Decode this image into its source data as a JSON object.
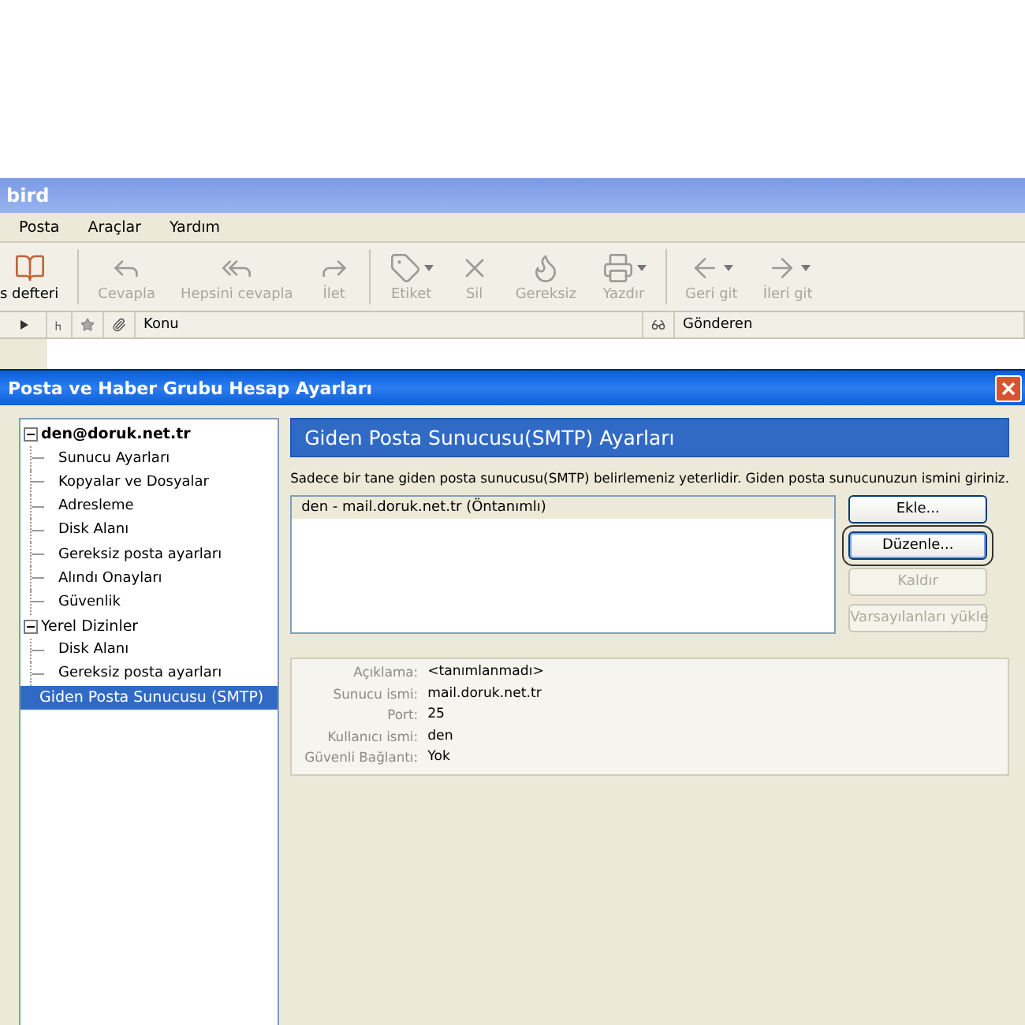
{
  "app_window": {
    "title": "bird"
  },
  "menu": [
    "Posta",
    "Araçlar",
    "Yardım"
  ],
  "toolbar": [
    {
      "label": "s defteri",
      "disabled": false,
      "has_menu": false
    },
    {
      "label": "Cevapla",
      "disabled": true,
      "has_menu": false
    },
    {
      "label": "Hepsini cevapla",
      "disabled": true,
      "has_menu": false
    },
    {
      "label": "İlet",
      "disabled": true,
      "has_menu": false
    },
    {
      "label": "Etiket",
      "disabled": true,
      "has_menu": true
    },
    {
      "label": "Sil",
      "disabled": true,
      "has_menu": false
    },
    {
      "label": "Gereksiz",
      "disabled": true,
      "has_menu": false
    },
    {
      "label": "Yazdır",
      "disabled": true,
      "has_menu": true
    },
    {
      "label": "Geri git",
      "disabled": true,
      "has_menu": true
    },
    {
      "label": "İleri git",
      "disabled": true,
      "has_menu": true
    }
  ],
  "message_columns": [
    "Konu",
    "Gönderen"
  ],
  "dialog": {
    "title": "Posta ve Haber Grubu Hesap Ayarları",
    "tree": [
      {
        "label": "den@doruk.net.tr",
        "bold": true,
        "selected": false,
        "expanded": true,
        "children": [
          {
            "label": "Sunucu Ayarları",
            "selected": false
          },
          {
            "label": "Kopyalar ve Dosyalar",
            "selected": false
          },
          {
            "label": "Adresleme",
            "selected": false
          },
          {
            "label": "Disk Alanı",
            "selected": false
          },
          {
            "label": "Gereksiz posta ayarları",
            "selected": false
          },
          {
            "label": "Alındı Onayları",
            "selected": false
          },
          {
            "label": "Güvenlik",
            "selected": false
          }
        ]
      },
      {
        "label": "Yerel Dizinler",
        "bold": false,
        "selected": false,
        "expanded": true,
        "children": [
          {
            "label": "Disk Alanı",
            "selected": false
          },
          {
            "label": "Gereksiz posta ayarları",
            "selected": false
          }
        ]
      },
      {
        "label": "Giden Posta Sunucusu (SMTP)",
        "bold": false,
        "selected": true
      }
    ],
    "heading": "Giden Posta Sunucusu(SMTP) Ayarları",
    "description": "Sadece bir tane giden posta sunucusu(SMTP) belirlemeniz yeterlidir. Giden posta sunucunuzun ismini giriniz.",
    "servers": [
      {
        "label": "den - mail.doruk.net.tr (Öntanımlı)",
        "selected": true
      }
    ],
    "buttons": [
      {
        "label": "Ekle...",
        "disabled": false,
        "focused": false
      },
      {
        "label": "Düzenle...",
        "disabled": false,
        "focused": true
      },
      {
        "label": "Kaldır",
        "disabled": true,
        "focused": false
      },
      {
        "label": "Varsayılanları yükle",
        "disabled": true,
        "focused": false
      }
    ],
    "details": [
      {
        "label": "Açıklama:",
        "value": "<tanımlanmadı>"
      },
      {
        "label": "Sunucu ismi:",
        "value": "mail.doruk.net.tr"
      },
      {
        "label": "Port:",
        "value": "25"
      },
      {
        "label": "Kullanıcı ismi:",
        "value": "den"
      },
      {
        "label": "Güvenli Bağlantı:",
        "value": "Yok"
      }
    ]
  }
}
